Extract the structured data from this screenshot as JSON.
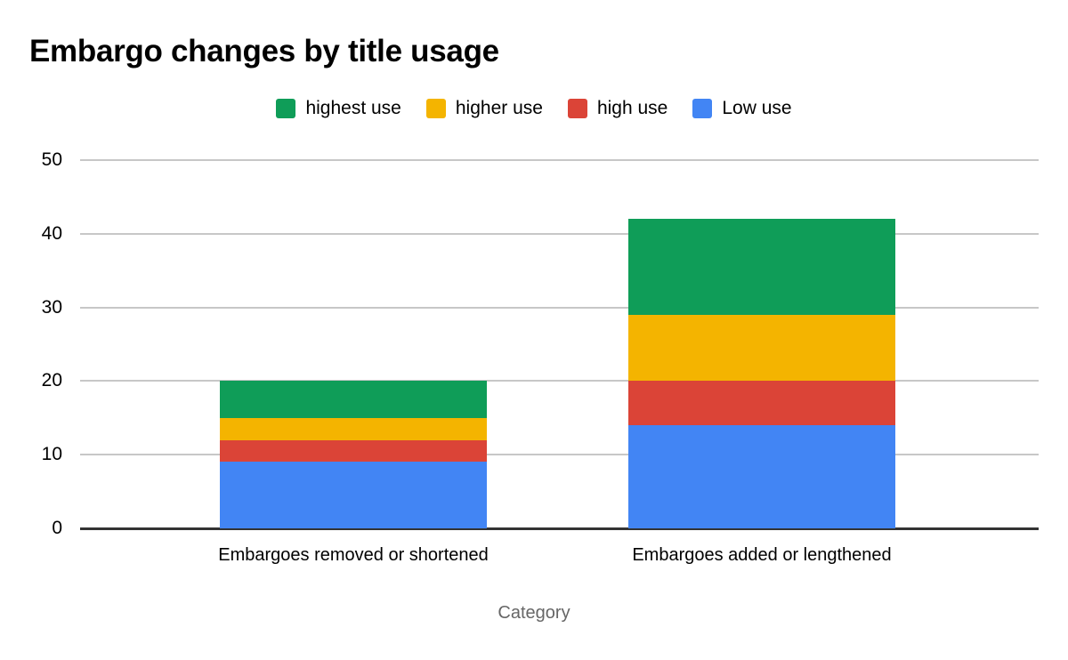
{
  "chart_data": {
    "type": "bar",
    "title": "Embargo changes by title usage",
    "xlabel": "Category",
    "ylabel": "",
    "stacked": true,
    "grid": true,
    "legend_position": "top-center",
    "ylim": [
      0,
      50
    ],
    "yticks": [
      0,
      10,
      20,
      30,
      40,
      50
    ],
    "categories": [
      "Embargoes removed or shortened",
      "Embargoes added or lengthened"
    ],
    "series": [
      {
        "name": "Low use",
        "color": "#4285f4",
        "values": [
          9,
          14
        ]
      },
      {
        "name": "high use",
        "color": "#db4437",
        "values": [
          3,
          6
        ]
      },
      {
        "name": "higher use",
        "color": "#f4b400",
        "values": [
          3,
          9
        ]
      },
      {
        "name": "highest use",
        "color": "#0f9d58",
        "values": [
          5,
          13
        ]
      }
    ],
    "totals": [
      20,
      42
    ],
    "legend_order": [
      "highest use",
      "higher use",
      "high use",
      "Low use"
    ]
  },
  "legend": {
    "items": [
      {
        "label": "highest use",
        "color": "#0f9d58"
      },
      {
        "label": "higher use",
        "color": "#f4b400"
      },
      {
        "label": "high use",
        "color": "#db4437"
      },
      {
        "label": "Low use",
        "color": "#4285f4"
      }
    ]
  },
  "axis": {
    "y_ticks": [
      "50",
      "40",
      "30",
      "20",
      "10",
      "0"
    ],
    "x_labels": [
      "Embargoes removed or shortened",
      "Embargoes added or lengthened"
    ],
    "x_title": "Category"
  }
}
